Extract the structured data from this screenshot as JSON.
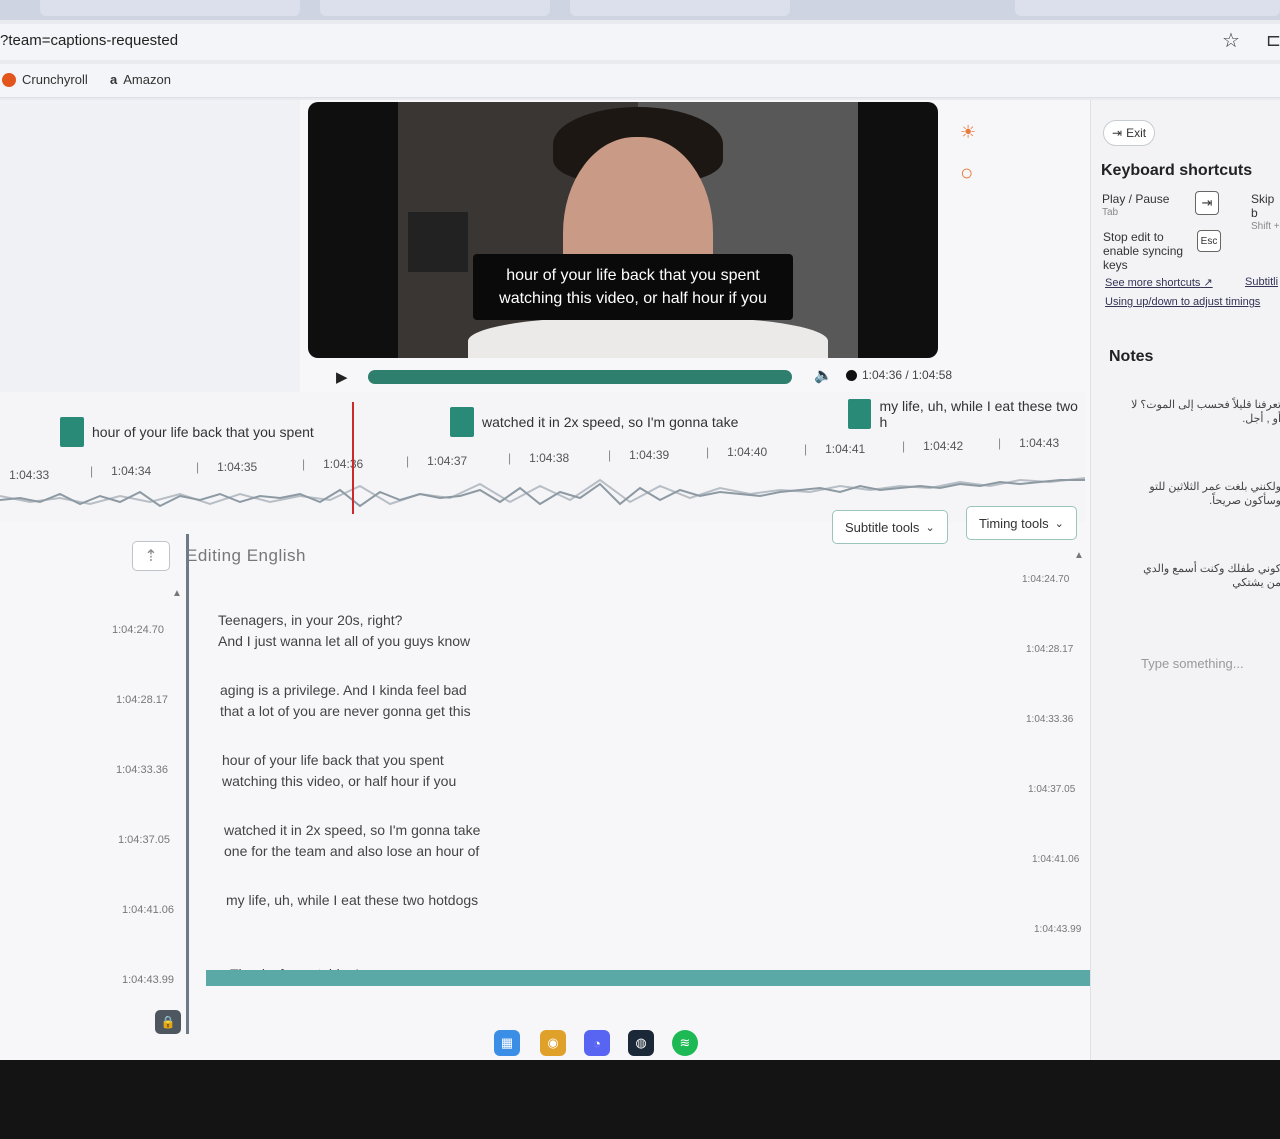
{
  "browser": {
    "url": "?team=captions-requested",
    "bookmarks": [
      {
        "label": "Crunchyroll",
        "icon": "crunchyroll-icon"
      },
      {
        "label": "Amazon",
        "icon": "amazon-icon"
      }
    ]
  },
  "video": {
    "caption_line1": "hour of your life back that you spent",
    "caption_line2": "watching this video, or half hour if you"
  },
  "player": {
    "time": "1:04:36 / 1:04:58"
  },
  "timeline": {
    "cues": [
      "hour of your life back that you spent",
      "watched it in 2x speed, so I'm gonna take",
      "my life, uh, while I eat these two h"
    ],
    "ticks": [
      "1:04:33",
      "1:04:34",
      "1:04:35",
      "1:04:36",
      "1:04:37",
      "1:04:38",
      "1:04:39",
      "1:04:40",
      "1:04:41",
      "1:04:42",
      "1:04:43"
    ]
  },
  "tools": {
    "subtitle": "Subtitle tools",
    "timing": "Timing tools"
  },
  "editor": {
    "title": "Editing English",
    "rows": [
      {
        "start": "1:04:24.70",
        "line1": "Teenagers, in your 20s, right?",
        "line2": "And I just wanna let all of you guys know",
        "end": "1:04:24.70"
      },
      {
        "start": "1:04:28.17",
        "line1": "aging is a privilege. And I kinda feel bad",
        "line2": "that a lot of you are never gonna get this",
        "end": "1:04:28.17"
      },
      {
        "start": "1:04:33.36",
        "line1": "hour of your life back that you spent",
        "line2": "watching this video, or half hour if you",
        "end": "1:04:33.36"
      },
      {
        "start": "1:04:37.05",
        "line1": "watched it in 2x speed, so I'm gonna take",
        "line2": "one for the team and also lose an hour of",
        "end": "1:04:37.05"
      },
      {
        "start": "1:04:41.06",
        "line1": "my life, uh, while I eat these two hotdogs",
        "line2": "",
        "end": "1:04:41.06"
      },
      {
        "start": "1:04:43.99",
        "line1": "Thanks for watching!",
        "line2": "",
        "end": "1:04:43.99"
      }
    ]
  },
  "panel": {
    "exit": "Exit",
    "shortcuts_title": "Keyboard shortcuts",
    "play_pause": "Play / Pause",
    "play_pause_key": "Tab",
    "skip": "Skip b",
    "skip_key": "Shift +",
    "stop_edit": "Stop edit to enable syncing keys",
    "esc": "Esc",
    "see_more": "See more shortcuts",
    "subtitle_link": "Subtitli",
    "using_updown": "Using up/down to adjust timings",
    "notes_title": "Notes",
    "note1": "تعرفنا قليلاً فحسب إلى الموت؟ لا أو , أجل.",
    "note2": "ولكنني بلغت عمر الثلاثين للتو وسأكون صريحاً.",
    "note3": "كوني طفلك وكنت أسمع والدي من يشتكي",
    "note_placeholder": "Type something..."
  },
  "colors": {
    "accent": "#2f7f6e",
    "playhead": "#cc2a2a",
    "bottombar": "#5aa9a6"
  }
}
